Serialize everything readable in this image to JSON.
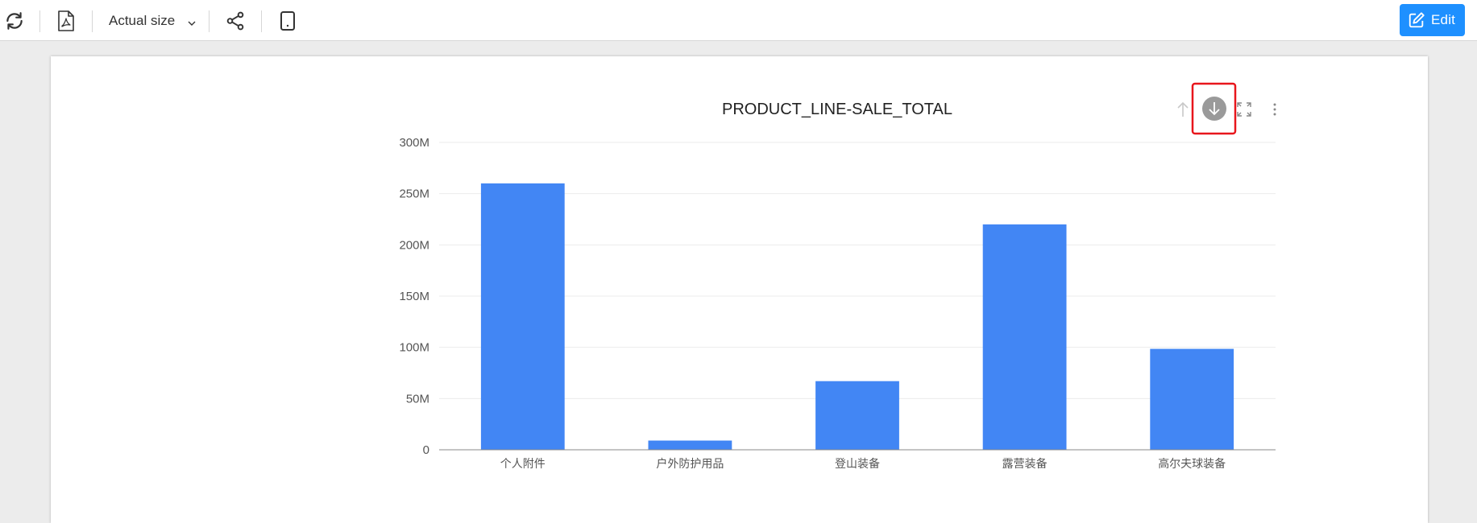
{
  "toolbar": {
    "refresh_icon": "refresh-icon",
    "export_pdf_icon": "pdf-icon",
    "zoom": {
      "selected": "Actual size"
    },
    "share_icon": "share-icon",
    "mobile_icon": "tablet-icon",
    "edit_label": "Edit",
    "edit_icon": "edit-icon"
  },
  "chart_tools": {
    "sort_up_icon": "arrow-up-icon",
    "download_icon": "download-icon",
    "fullscreen_icon": "fullscreen-icon",
    "more_icon": "more-vertical-icon",
    "highlight_color": "#e8161c"
  },
  "colors": {
    "bar": "#4286f4",
    "accent": "#1e90ff"
  },
  "chart_data": {
    "type": "bar",
    "title": "PRODUCT_LINE-SALE_TOTAL",
    "categories": [
      "个人附件",
      "户外防护用品",
      "登山装备",
      "露营装备",
      "高尔夫球装备"
    ],
    "values": [
      260000000,
      9000000,
      67000000,
      220000000,
      98500000
    ],
    "ylim": [
      0,
      300000000
    ],
    "yticks": [
      0,
      50000000,
      100000000,
      150000000,
      200000000,
      250000000,
      300000000
    ],
    "ytick_labels": [
      "0",
      "50M",
      "100M",
      "150M",
      "200M",
      "250M",
      "300M"
    ],
    "xlabel": "",
    "ylabel": "",
    "grid": true,
    "legend": "none"
  }
}
